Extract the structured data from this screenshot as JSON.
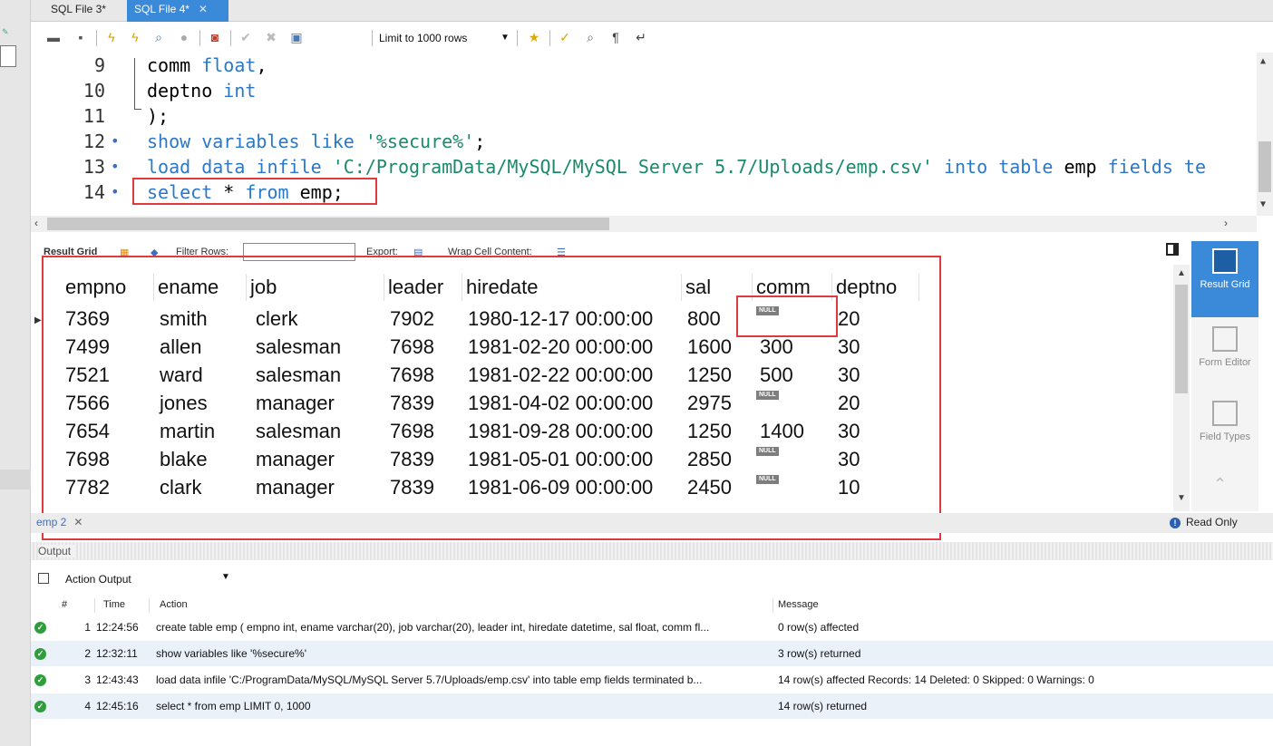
{
  "tabs": [
    {
      "label": "SQL File 3*",
      "active": false
    },
    {
      "label": "SQL File 4*",
      "active": true
    }
  ],
  "toolbar": {
    "limit_label": "Limit to 1000 rows",
    "icons": [
      "folder-icon",
      "save-icon",
      "execute-icon",
      "execute-current-icon",
      "explain-icon",
      "stop-icon",
      "toggle-results-icon",
      "commit-icon",
      "rollback-icon",
      "autocommit-icon",
      "limit-select",
      "bookmark-icon",
      "beautify-icon",
      "find-icon",
      "invisible-chars-icon",
      "wrap-icon"
    ]
  },
  "editor": {
    "lines": [
      {
        "num": "9",
        "dot": false,
        "tokens": [
          {
            "t": "comm ",
            "c": "plain"
          },
          {
            "t": "float",
            "c": "kw"
          },
          {
            "t": ",",
            "c": "plain"
          }
        ]
      },
      {
        "num": "10",
        "dot": false,
        "tokens": [
          {
            "t": "deptno ",
            "c": "plain"
          },
          {
            "t": "int",
            "c": "kw"
          }
        ]
      },
      {
        "num": "11",
        "dot": false,
        "tokens": [
          {
            "t": ");",
            "c": "plain"
          }
        ]
      },
      {
        "num": "12",
        "dot": true,
        "tokens": [
          {
            "t": "show variables like ",
            "c": "kw"
          },
          {
            "t": "'%secure%'",
            "c": "str"
          },
          {
            "t": ";",
            "c": "plain"
          }
        ]
      },
      {
        "num": "13",
        "dot": true,
        "tokens": [
          {
            "t": "load data infile ",
            "c": "kw"
          },
          {
            "t": "'C:/ProgramData/MySQL/MySQL Server 5.7/Uploads/emp.csv'",
            "c": "str"
          },
          {
            "t": " into table ",
            "c": "kw"
          },
          {
            "t": "emp ",
            "c": "plain"
          },
          {
            "t": "fields te",
            "c": "kw"
          }
        ]
      },
      {
        "num": "14",
        "dot": true,
        "tokens": [
          {
            "t": "select ",
            "c": "kw"
          },
          {
            "t": "* ",
            "c": "plain"
          },
          {
            "t": "from ",
            "c": "kw"
          },
          {
            "t": "emp;",
            "c": "plain"
          }
        ]
      }
    ]
  },
  "result_toolbar": {
    "result_grid": "Result Grid",
    "filter_rows": "Filter Rows:",
    "export": "Export:",
    "wrap": "Wrap Cell Content:"
  },
  "grid": {
    "columns": [
      "empno",
      "ename",
      "job",
      "leader",
      "hiredate",
      "sal",
      "comm",
      "deptno"
    ],
    "null_label": "NULL",
    "rows": [
      [
        "7369",
        "smith",
        "clerk",
        "7902",
        "1980-12-17 00:00:00",
        "800",
        null,
        "20"
      ],
      [
        "7499",
        "allen",
        "salesman",
        "7698",
        "1981-02-20 00:00:00",
        "1600",
        "300",
        "30"
      ],
      [
        "7521",
        "ward",
        "salesman",
        "7698",
        "1981-02-22 00:00:00",
        "1250",
        "500",
        "30"
      ],
      [
        "7566",
        "jones",
        "manager",
        "7839",
        "1981-04-02 00:00:00",
        "2975",
        null,
        "20"
      ],
      [
        "7654",
        "martin",
        "salesman",
        "7698",
        "1981-09-28 00:00:00",
        "1250",
        "1400",
        "30"
      ],
      [
        "7698",
        "blake",
        "manager",
        "7839",
        "1981-05-01 00:00:00",
        "2850",
        null,
        "30"
      ],
      [
        "7782",
        "clark",
        "manager",
        "7839",
        "1981-06-09 00:00:00",
        "2450",
        null,
        "10"
      ]
    ]
  },
  "side_panel": [
    {
      "label": "Result Grid",
      "active": true
    },
    {
      "label": "Form Editor",
      "active": false
    },
    {
      "label": "Field Types",
      "active": false
    }
  ],
  "result_tab": {
    "label": "emp 2",
    "status": "Read Only"
  },
  "output": {
    "title": "Output",
    "selector": "Action Output",
    "headers": {
      "num": "#",
      "time": "Time",
      "action": "Action",
      "message": "Message"
    },
    "rows": [
      {
        "num": "1",
        "time": "12:24:56",
        "action": "create table emp ( empno int, ename varchar(20), job varchar(20), leader int, hiredate datetime, sal float, comm fl...",
        "message": "0 row(s) affected"
      },
      {
        "num": "2",
        "time": "12:32:11",
        "action": "show variables like '%secure%'",
        "message": "3 row(s) returned"
      },
      {
        "num": "3",
        "time": "12:43:43",
        "action": "load data infile 'C:/ProgramData/MySQL/MySQL Server 5.7/Uploads/emp.csv' into table emp fields terminated b...",
        "message": "14 row(s) affected Records: 14  Deleted: 0  Skipped: 0  Warnings: 0"
      },
      {
        "num": "4",
        "time": "12:45:16",
        "action": "select * from emp LIMIT 0, 1000",
        "message": "14 row(s) returned"
      }
    ]
  },
  "colors": {
    "accent": "#3b8ad9",
    "highlight": "#e0393e",
    "ok": "#2e9e3a"
  }
}
